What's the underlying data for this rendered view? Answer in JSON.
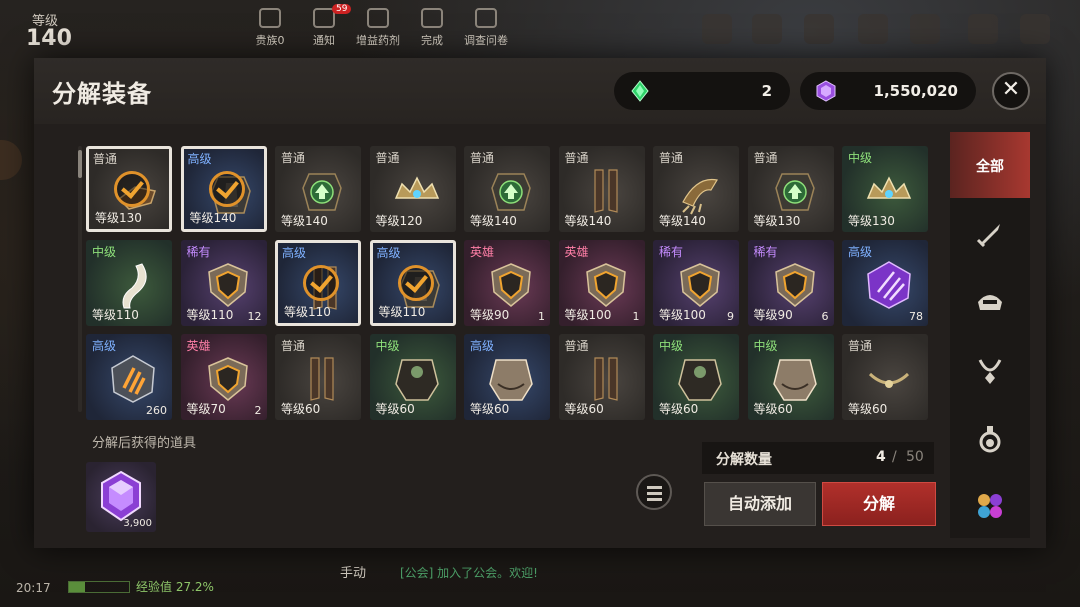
{
  "hud": {
    "level_label": "等级",
    "level_value": "140",
    "top_items": [
      {
        "label": "贵族0"
      },
      {
        "label": "通知",
        "badge": "59"
      },
      {
        "label": "增益药剂"
      },
      {
        "label": "完成"
      },
      {
        "label": "调查问卷"
      }
    ],
    "clock": "20:17",
    "exp_text": "经验值 27.2%",
    "exp_fraction": 0.272,
    "chat_mode": "手动",
    "chat_message": "[公会] 加入了公会。欢迎!"
  },
  "modal": {
    "title": "分解装备",
    "currencies": [
      {
        "icon": "green-crystal-icon",
        "value": "2"
      },
      {
        "icon": "purple-gem-icon",
        "value": "1,550,020"
      }
    ],
    "close_label": "✕",
    "categories": [
      {
        "label": "全部",
        "icon": "all-tab",
        "active": true
      },
      {
        "label": "",
        "icon": "sword-icon"
      },
      {
        "label": "",
        "icon": "helmet-icon"
      },
      {
        "label": "",
        "icon": "necklace-icon"
      },
      {
        "label": "",
        "icon": "potion-icon"
      },
      {
        "label": "",
        "icon": "gems-icon"
      }
    ],
    "items": [
      {
        "tier": "普通",
        "tier_class": "normal",
        "level": "等级130",
        "count": "",
        "art": "gauntlet",
        "selected": true
      },
      {
        "tier": "高级",
        "tier_class": "high",
        "level": "等级140",
        "count": "",
        "art": "armor",
        "selected": true
      },
      {
        "tier": "普通",
        "tier_class": "normal",
        "level": "等级140",
        "count": "",
        "art": "armor-up",
        "selected": false
      },
      {
        "tier": "普通",
        "tier_class": "normal",
        "level": "等级120",
        "count": "",
        "art": "crown",
        "selected": false
      },
      {
        "tier": "普通",
        "tier_class": "normal",
        "level": "等级140",
        "count": "",
        "art": "armor-up",
        "selected": false
      },
      {
        "tier": "普通",
        "tier_class": "normal",
        "level": "等级140",
        "count": "",
        "art": "greaves",
        "selected": false
      },
      {
        "tier": "普通",
        "tier_class": "normal",
        "level": "等级140",
        "count": "",
        "art": "claw",
        "selected": false
      },
      {
        "tier": "普通",
        "tier_class": "normal",
        "level": "等级130",
        "count": "",
        "art": "armor-up",
        "selected": false
      },
      {
        "tier": "中级",
        "tier_class": "mid",
        "level": "等级130",
        "count": "",
        "art": "crown",
        "selected": false
      },
      {
        "tier": "中级",
        "tier_class": "mid",
        "level": "等级110",
        "count": "",
        "art": "horn",
        "selected": false
      },
      {
        "tier": "稀有",
        "tier_class": "rare",
        "level": "等级110",
        "count": "12",
        "art": "shield",
        "selected": false
      },
      {
        "tier": "高级",
        "tier_class": "high",
        "level": "等级110",
        "count": "",
        "art": "greaves",
        "selected": true
      },
      {
        "tier": "高级",
        "tier_class": "high",
        "level": "等级110",
        "count": "",
        "art": "armor",
        "selected": true
      },
      {
        "tier": "英雄",
        "tier_class": "hero",
        "level": "等级90",
        "count": "1",
        "art": "shield",
        "selected": false
      },
      {
        "tier": "英雄",
        "tier_class": "hero",
        "level": "等级100",
        "count": "1",
        "art": "shield",
        "selected": false
      },
      {
        "tier": "稀有",
        "tier_class": "rare",
        "level": "等级100",
        "count": "9",
        "art": "shield",
        "selected": false
      },
      {
        "tier": "稀有",
        "tier_class": "rare",
        "level": "等级90",
        "count": "6",
        "art": "shield",
        "selected": false
      },
      {
        "tier": "高级",
        "tier_class": "high",
        "level": "",
        "count": "78",
        "art": "purple-crystal",
        "selected": false
      },
      {
        "tier": "高级",
        "tier_class": "high",
        "level": "",
        "count": "260",
        "art": "claw-stone",
        "selected": false
      },
      {
        "tier": "英雄",
        "tier_class": "hero",
        "level": "等级70",
        "count": "2",
        "art": "shield",
        "selected": false
      },
      {
        "tier": "普通",
        "tier_class": "normal",
        "level": "等级60",
        "count": "",
        "art": "greaves",
        "selected": false
      },
      {
        "tier": "中级",
        "tier_class": "mid",
        "level": "等级60",
        "count": "",
        "art": "robe",
        "selected": false
      },
      {
        "tier": "高级",
        "tier_class": "high",
        "level": "等级60",
        "count": "",
        "art": "robe-light",
        "selected": false
      },
      {
        "tier": "普通",
        "tier_class": "normal",
        "level": "等级60",
        "count": "",
        "art": "greaves",
        "selected": false
      },
      {
        "tier": "中级",
        "tier_class": "mid",
        "level": "等级60",
        "count": "",
        "art": "robe",
        "selected": false
      },
      {
        "tier": "中级",
        "tier_class": "mid",
        "level": "等级60",
        "count": "",
        "art": "robe-light",
        "selected": false
      },
      {
        "tier": "普通",
        "tier_class": "normal",
        "level": "等级60",
        "count": "",
        "art": "necklace",
        "selected": false
      }
    ],
    "obtain_label": "分解后获得的道具",
    "obtain_item": {
      "icon": "purple-gem-icon",
      "count": "3,900"
    },
    "quantity_label": "分解数量",
    "quantity_current": "4",
    "quantity_separator": "/",
    "quantity_max": "50",
    "auto_add_label": "自动添加",
    "disassemble_label": "分解"
  }
}
